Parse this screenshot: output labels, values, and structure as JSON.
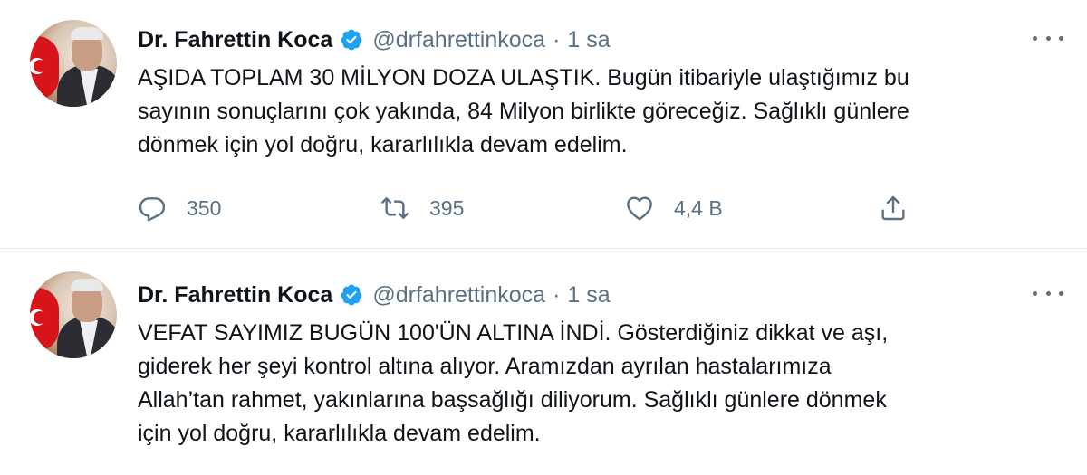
{
  "tweets": [
    {
      "author_name": "Dr. Fahrettin Koca",
      "handle": "@drfahrettinkoca",
      "separator": "·",
      "time": "1 sa",
      "text_lines": [
        "AŞIDA TOPLAM 30 MİLYON DOZA ULAŞTIK. Bugün itibariyle ulaştığımız bu",
        "sayının sonuçlarını çok yakında, 84 Milyon birlikte göreceğiz. Sağlıklı günlere",
        "dönmek için yol doğru, kararlılıkla devam edelim."
      ],
      "replies": "350",
      "retweets": "395",
      "likes": "4,4 B"
    },
    {
      "author_name": "Dr. Fahrettin Koca",
      "handle": "@drfahrettinkoca",
      "separator": "·",
      "time": "1 sa",
      "text_lines": [
        "VEFAT SAYIMIZ BUGÜN 100'ÜN ALTINA İNDİ. Gösterdiğiniz dikkat ve aşı,",
        "giderek her şeyi kontrol altına alıyor. Aramızdan ayrılan hastalarımıza",
        "Allah’tan rahmet, yakınlarına başsağlığı diliyorum. Sağlıklı günlere dönmek",
        "için yol doğru, kararlılıkla devam edelim."
      ]
    }
  ],
  "icons": {
    "verified": "verified-badge-icon",
    "more": "more-options-icon",
    "reply": "reply-icon",
    "retweet": "retweet-icon",
    "like": "like-heart-icon",
    "share": "share-icon"
  },
  "colors": {
    "text": "#0f1419",
    "secondary": "#5b7083",
    "verified": "#1da1f2",
    "divider": "#e6ecf0"
  }
}
